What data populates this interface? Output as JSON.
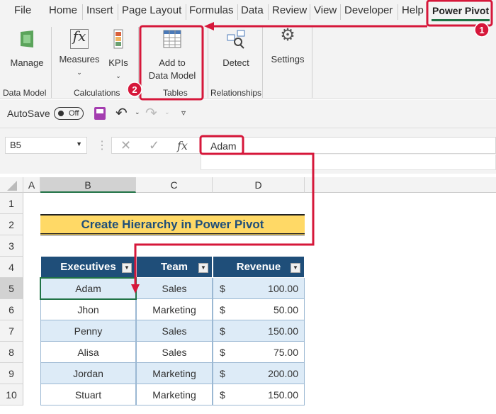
{
  "tabs": [
    "File",
    "Home",
    "Insert",
    "Page Layout",
    "Formulas",
    "Data",
    "Review",
    "View",
    "Developer",
    "Help",
    "Power Pivot"
  ],
  "ribbon": {
    "manage": "Manage",
    "measures": "Measures",
    "kpis": "KPIs",
    "add_l1": "Add to",
    "add_l2": "Data Model",
    "detect": "Detect",
    "settings": "Settings",
    "groups": {
      "data_model": "Data Model",
      "calculations": "Calculations",
      "tables": "Tables",
      "relationships": "Relationships"
    }
  },
  "qat": {
    "autosave": "AutoSave",
    "toggle": "Off"
  },
  "formula_bar": {
    "name_box": "B5",
    "value": "Adam"
  },
  "columns": [
    "A",
    "B",
    "C",
    "D"
  ],
  "rows": [
    "1",
    "2",
    "3",
    "4",
    "5",
    "6",
    "7",
    "8",
    "9",
    "10"
  ],
  "sheet": {
    "title": "Create Hierarchy in Power Pivot",
    "headers": [
      "Executives",
      "Team",
      "Revenue"
    ],
    "currency": "$",
    "data": [
      [
        "Adam",
        "Sales",
        "100.00"
      ],
      [
        "Jhon",
        "Marketing",
        "50.00"
      ],
      [
        "Penny",
        "Sales",
        "150.00"
      ],
      [
        "Alisa",
        "Sales",
        "75.00"
      ],
      [
        "Jordan",
        "Marketing",
        "200.00"
      ],
      [
        "Stuart",
        "Marketing",
        "150.00"
      ]
    ]
  },
  "annotations": {
    "step1": "1",
    "step2": "2"
  },
  "colors": {
    "accent": "#d6173a",
    "header": "#1f4e79",
    "title_bg": "#ffd966",
    "band": "#ddebf7"
  }
}
